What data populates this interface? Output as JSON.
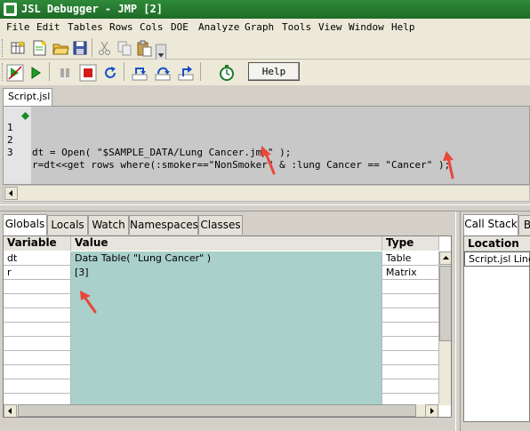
{
  "window": {
    "title": "JSL Debugger - JMP [2]"
  },
  "menu": [
    "File",
    "Edit",
    "Tables",
    "Rows",
    "Cols",
    "DOE",
    "Analyze",
    "Graph",
    "Tools",
    "View",
    "Window",
    "Help"
  ],
  "toolbar2": {
    "help_label": "Help"
  },
  "editor": {
    "tab_label": "Script.jsl",
    "lines": [
      {
        "num": "1",
        "code": "dt = Open( \"$SAMPLE_DATA/Lung Cancer.jmp\" );"
      },
      {
        "num": "2",
        "code": ""
      },
      {
        "num": "3",
        "code": "r=dt<<get rows where(:smoker==\"NonSmoker\" & :lung Cancer == \"Cancer\" );"
      }
    ]
  },
  "bottom_tabs": [
    "Globals",
    "Locals",
    "Watch",
    "Namespaces",
    "Classes"
  ],
  "variables": {
    "headers": {
      "variable": "Variable",
      "value": "Value",
      "type": "Type"
    },
    "rows": [
      {
        "variable": "dt",
        "value": "Data Table( \"Lung Cancer\" )",
        "type": "Table"
      },
      {
        "variable": "r",
        "value": "[3]",
        "type": "Matrix"
      }
    ]
  },
  "right_panel": {
    "tabs": [
      "Call Stack",
      "B"
    ],
    "header": "Location",
    "rows": [
      "Script.jsl Line"
    ]
  },
  "colors": {
    "title_bar": "#2e8a39",
    "value_column": "#a9d0cb",
    "annotation_arrow": "#e8473a"
  }
}
